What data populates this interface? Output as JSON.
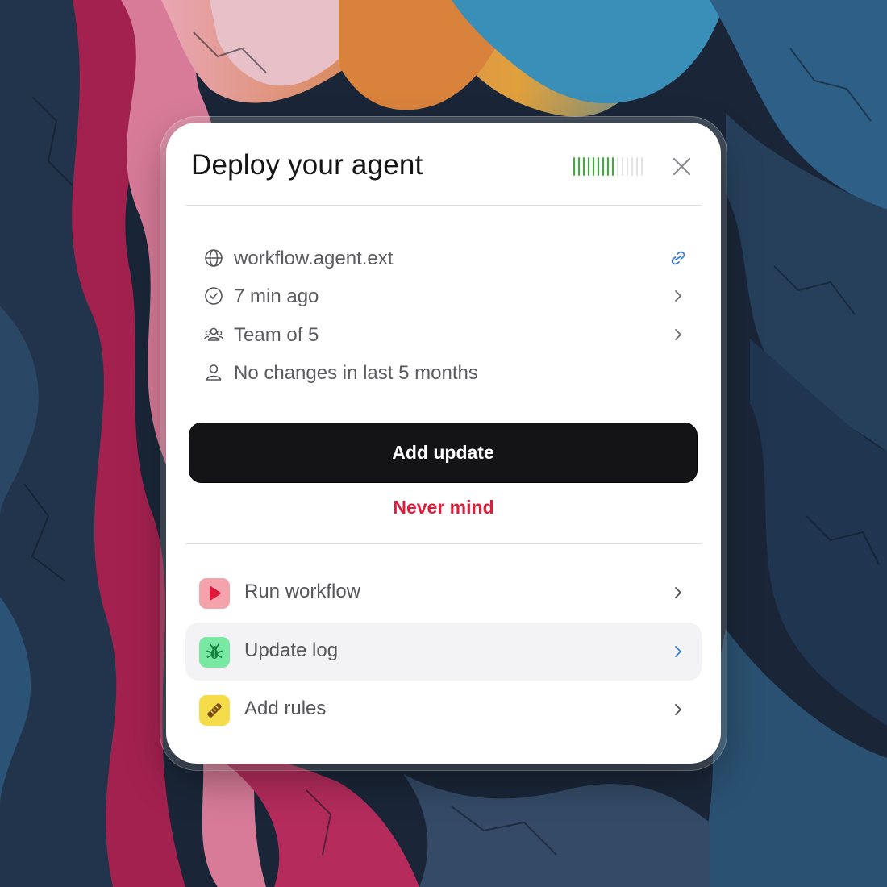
{
  "dialog": {
    "title": "Deploy your agent",
    "progress": {
      "filled_ticks": 9,
      "total_ticks": 15
    },
    "colors": {
      "progress_on": "#2fb82f",
      "progress_off": "#e2e2e6",
      "link_icon": "#3b7fe0"
    }
  },
  "info": [
    {
      "icon": "globe-icon",
      "text": "workflow.agent.ext",
      "trailing": "link-icon"
    },
    {
      "icon": "clock-icon",
      "text": "7 min ago",
      "trailing": "chevron-right-icon"
    },
    {
      "icon": "users-icon",
      "text": "Team of 5",
      "trailing": "chevron-right-icon"
    },
    {
      "icon": "user-icon",
      "text": "No changes in last 5 months",
      "trailing": ""
    }
  ],
  "buttons": {
    "primary": "Add update",
    "secondary": "Never mind",
    "colors": {
      "primary_bg": "#141416",
      "secondary_text": "#dc1e3a"
    }
  },
  "actions": [
    {
      "icon": "play-icon",
      "label": "Run workflow",
      "badge_color": "#f4a3ad",
      "highlighted": false
    },
    {
      "icon": "bug-icon",
      "label": "Update log",
      "badge_color": "#79e8a3",
      "highlighted": true
    },
    {
      "icon": "ruler-icon",
      "label": "Add rules",
      "badge_color": "#f5dc4a",
      "highlighted": false
    }
  ]
}
